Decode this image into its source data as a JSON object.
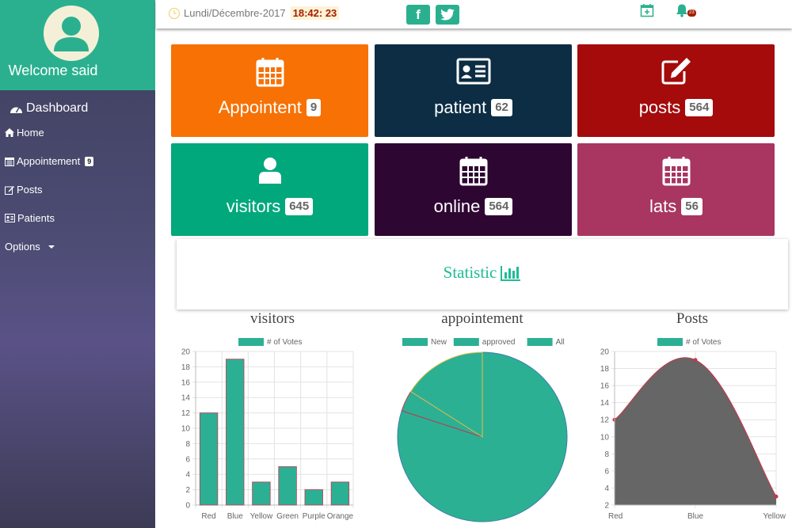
{
  "sidebar": {
    "welcome": "Welcome said",
    "dashboard": "Dashboard",
    "items": [
      {
        "label": "Home",
        "icon": "home-icon"
      },
      {
        "label": "Appointement",
        "icon": "calendar-icon",
        "badge": "9"
      },
      {
        "label": "Posts",
        "icon": "edit-icon"
      },
      {
        "label": "Patients",
        "icon": "id-card-icon"
      },
      {
        "label": "Options",
        "icon": "caret-down-icon"
      }
    ]
  },
  "topbar": {
    "date": "Lundi/Décembre-2017",
    "time": "18:42: 23",
    "bell_badge": "23"
  },
  "tiles": [
    {
      "label": "Appointent",
      "count": "9",
      "color": "#f77104",
      "icon": "calendar-icon"
    },
    {
      "label": "patient",
      "count": "62",
      "color": "#0c2d44",
      "icon": "id-card-icon"
    },
    {
      "label": "posts",
      "count": "564",
      "color": "#a50b0b",
      "icon": "edit-icon"
    },
    {
      "label": "visitors",
      "count": "645",
      "color": "#00a87c",
      "icon": "user-icon"
    },
    {
      "label": "online",
      "count": "564",
      "color": "#2e0632",
      "icon": "calendar-icon"
    },
    {
      "label": "lats",
      "count": "56",
      "color": "#a83660",
      "icon": "calendar-icon"
    }
  ],
  "statistic": {
    "title": "Statistic"
  },
  "colors": {
    "accent": "#2bb08f",
    "chart_fill": "#2cb094",
    "area_fill": "#666666",
    "line": "#c0394f"
  },
  "chart_data": [
    {
      "type": "bar",
      "title": "visitors",
      "legend": "# of Votes",
      "categories": [
        "Red",
        "Blue",
        "Yellow",
        "Green",
        "Purple",
        "Orange"
      ],
      "values": [
        12,
        19,
        3,
        5,
        2,
        3
      ],
      "ylim": [
        0,
        20
      ],
      "yticks": [
        0,
        2,
        4,
        6,
        8,
        10,
        12,
        14,
        16,
        18,
        20
      ]
    },
    {
      "type": "pie",
      "title": "appointement",
      "labels": [
        "New",
        "approved",
        "All"
      ],
      "values": [
        40,
        2,
        8
      ]
    },
    {
      "type": "area",
      "title": "Posts",
      "legend": "# of Votes",
      "categories": [
        "Red",
        "Blue",
        "Yellow"
      ],
      "values": [
        12,
        19,
        3
      ],
      "ylim": [
        2,
        20
      ],
      "yticks": [
        2,
        4,
        6,
        8,
        10,
        12,
        14,
        16,
        18,
        20
      ]
    }
  ]
}
